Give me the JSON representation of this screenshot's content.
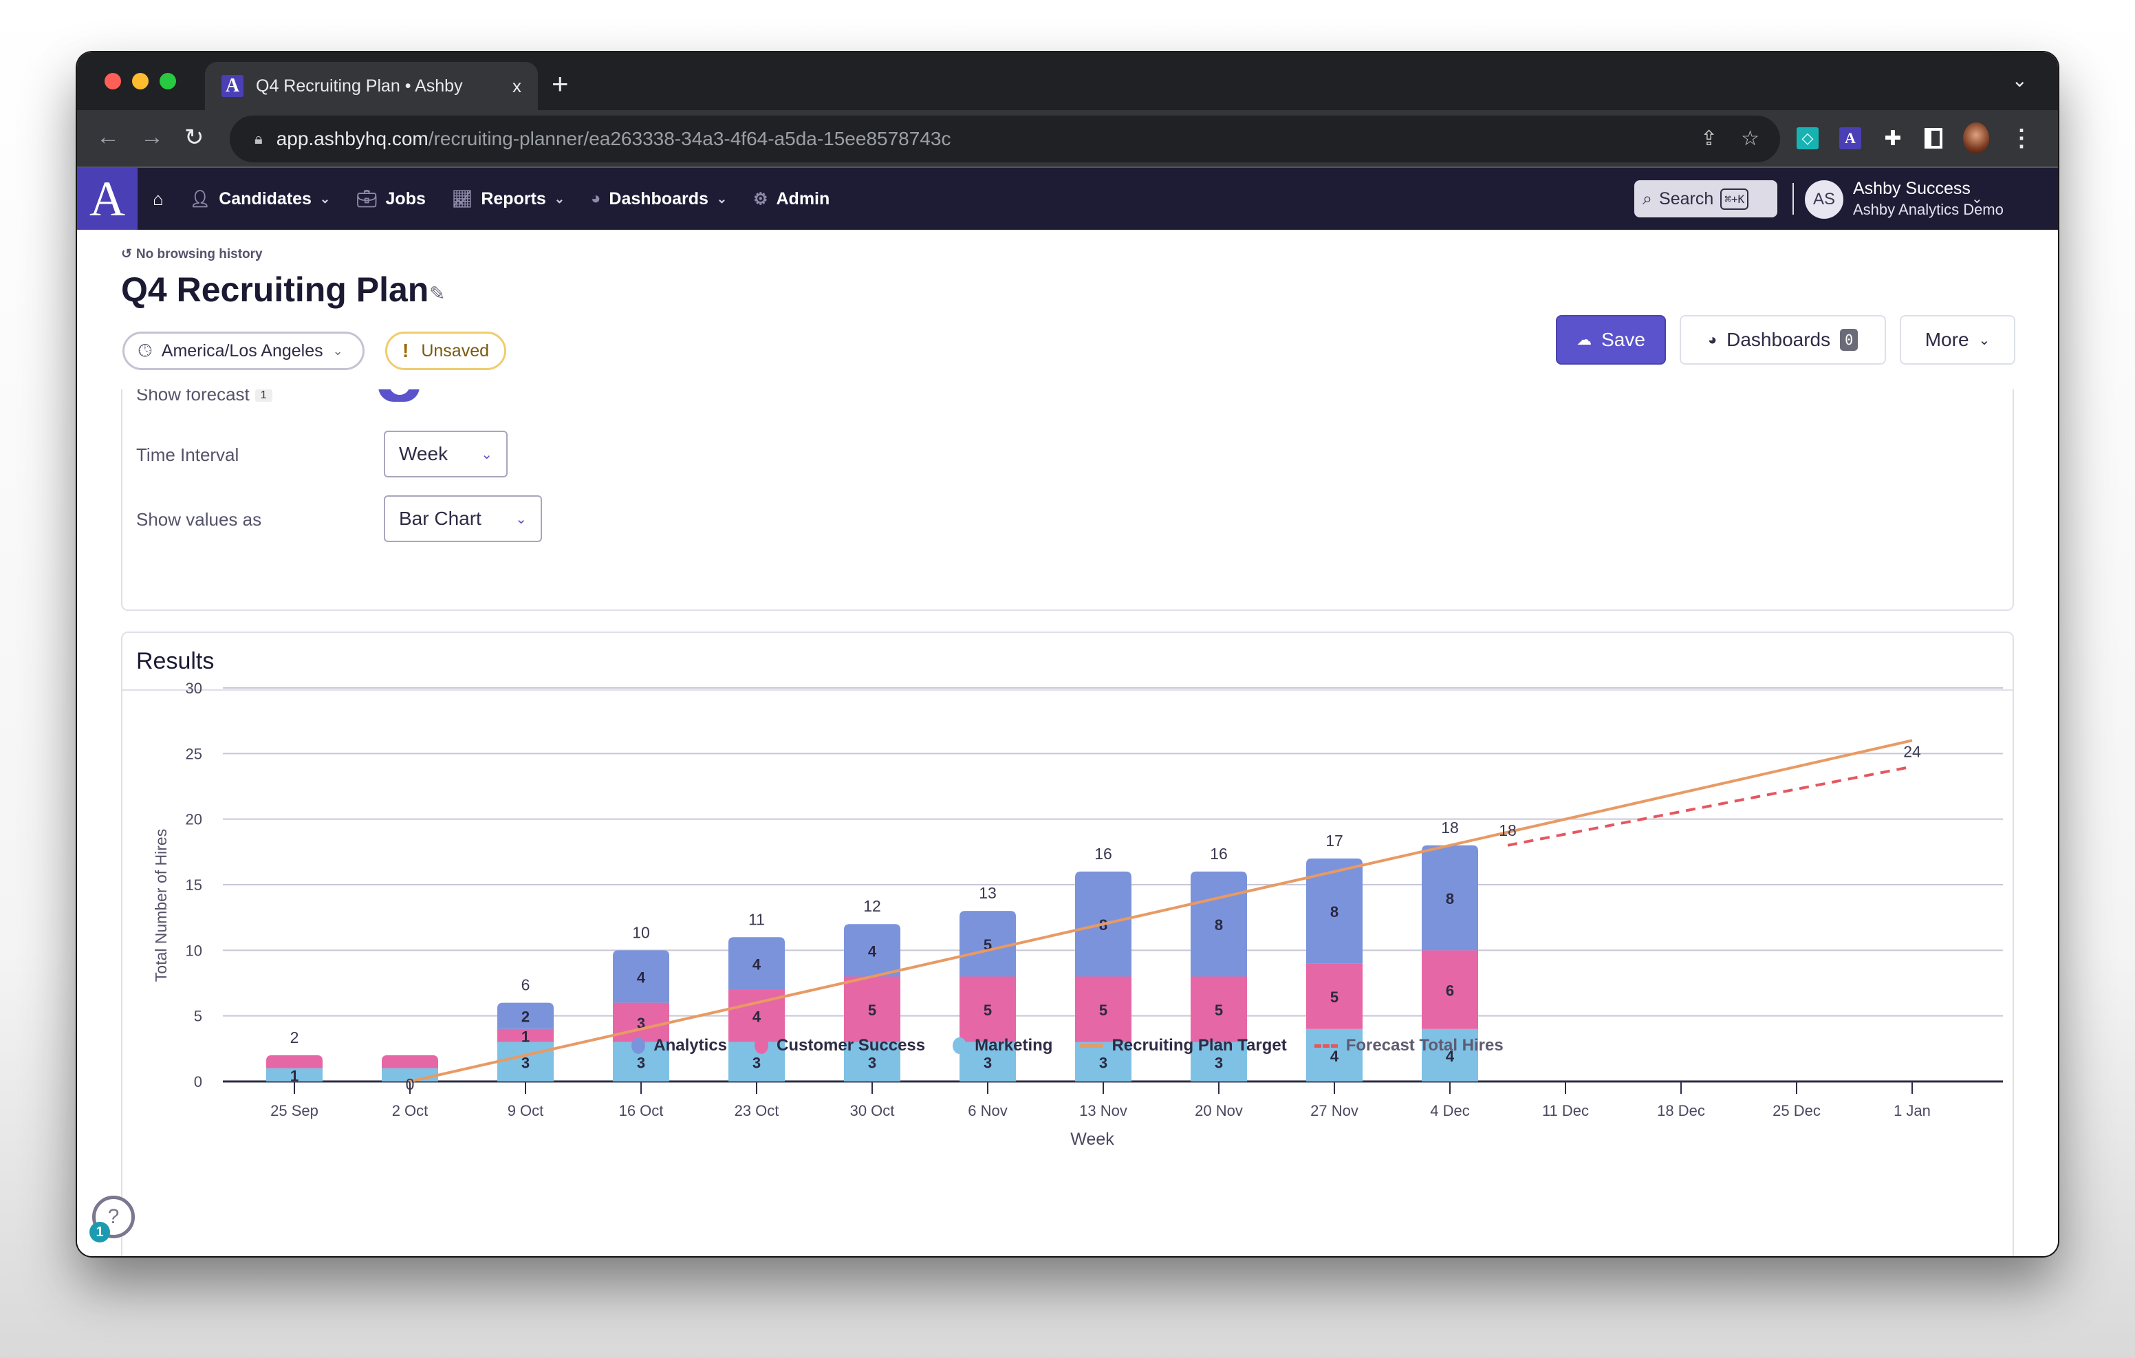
{
  "browser": {
    "tab_title": "Q4 Recruiting Plan • Ashby",
    "tab_close": "x",
    "new_tab": "+",
    "url_host": "app.ashbyhq.com",
    "url_path": "/recruiting-planner/ea263338-34a3-4f64-a5da-15ee8578743c"
  },
  "nav": {
    "logo": "A",
    "items": [
      {
        "label": "Candidates",
        "icon": "candidates-icon",
        "has_dropdown": true
      },
      {
        "label": "Jobs",
        "icon": "briefcase-icon",
        "has_dropdown": false
      },
      {
        "label": "Reports",
        "icon": "chart-icon",
        "has_dropdown": true
      },
      {
        "label": "Dashboards",
        "icon": "gauge-icon",
        "has_dropdown": true
      },
      {
        "label": "Admin",
        "icon": "gear-icon",
        "has_dropdown": false
      }
    ],
    "search_label": "Search",
    "search_shortcut": "⌘+K",
    "user_initials": "AS",
    "user_name": "Ashby Success",
    "user_org": "Ashby Analytics Demo"
  },
  "page": {
    "history": "No browsing history",
    "title": "Q4 Recruiting Plan",
    "timezone": "America/Los Angeles",
    "status": "Unsaved",
    "save_label": "Save",
    "dashboards_label": "Dashboards",
    "dashboards_count": "0",
    "more_label": "More"
  },
  "settings": {
    "show_forecast_label": "Show forecast",
    "show_forecast_info": "1",
    "show_forecast_on": true,
    "time_interval_label": "Time Interval",
    "time_interval_value": "Week",
    "show_values_label": "Show values as",
    "show_values_value": "Bar Chart"
  },
  "results": {
    "title": "Results"
  },
  "help": {
    "icon": "?",
    "badge": "1"
  },
  "colors": {
    "accent": "#5b53cc",
    "analytics": "#7b93db",
    "customer_success": "#e667a5",
    "marketing": "#7fc1e4",
    "target": "#e89a64",
    "forecast": "#e5575f"
  },
  "chart_data": {
    "type": "bar",
    "stacked": true,
    "title": "",
    "xlabel": "Week",
    "ylabel": "Total Number of Hires",
    "ylim": [
      0,
      30
    ],
    "yticks": [
      0,
      5,
      10,
      15,
      20,
      25,
      30
    ],
    "grid": true,
    "legend_position": "bottom-center",
    "categories": [
      "25 Sep",
      "2 Oct",
      "9 Oct",
      "16 Oct",
      "23 Oct",
      "30 Oct",
      "6 Nov",
      "13 Nov",
      "20 Nov",
      "27 Nov",
      "4 Dec",
      "11 Dec",
      "18 Dec",
      "25 Dec",
      "1 Jan"
    ],
    "series": [
      {
        "name": "Marketing",
        "values": [
          1,
          1,
          3,
          3,
          3,
          3,
          3,
          3,
          3,
          4,
          4,
          null,
          null,
          null,
          null
        ]
      },
      {
        "name": "Customer Success",
        "values": [
          1,
          1,
          1,
          3,
          4,
          5,
          5,
          5,
          5,
          5,
          6,
          null,
          null,
          null,
          null
        ]
      },
      {
        "name": "Analytics",
        "values": [
          0,
          0,
          2,
          4,
          4,
          4,
          5,
          8,
          8,
          8,
          8,
          null,
          null,
          null,
          null
        ]
      }
    ],
    "totals": [
      2,
      null,
      6,
      10,
      11,
      12,
      13,
      16,
      16,
      17,
      18,
      null,
      null,
      null,
      null
    ],
    "lines": [
      {
        "name": "Recruiting Plan Target",
        "style": "solid",
        "points": [
          {
            "x": 1,
            "y": 0
          },
          {
            "x": 14,
            "y": 26
          }
        ],
        "labels": [
          {
            "x": 1,
            "y": 0,
            "text": "0"
          }
        ]
      },
      {
        "name": "Forecast Total Hires",
        "style": "dashed",
        "points": [
          {
            "x": 10.5,
            "y": 18
          },
          {
            "x": 14,
            "y": 24
          }
        ],
        "labels": [
          {
            "x": 10.5,
            "y": 18,
            "text": "18"
          },
          {
            "x": 14,
            "y": 24,
            "text": "24"
          }
        ]
      }
    ],
    "legend": [
      "Analytics",
      "Customer Success",
      "Marketing",
      "Recruiting Plan Target",
      "Forecast Total Hires"
    ]
  }
}
